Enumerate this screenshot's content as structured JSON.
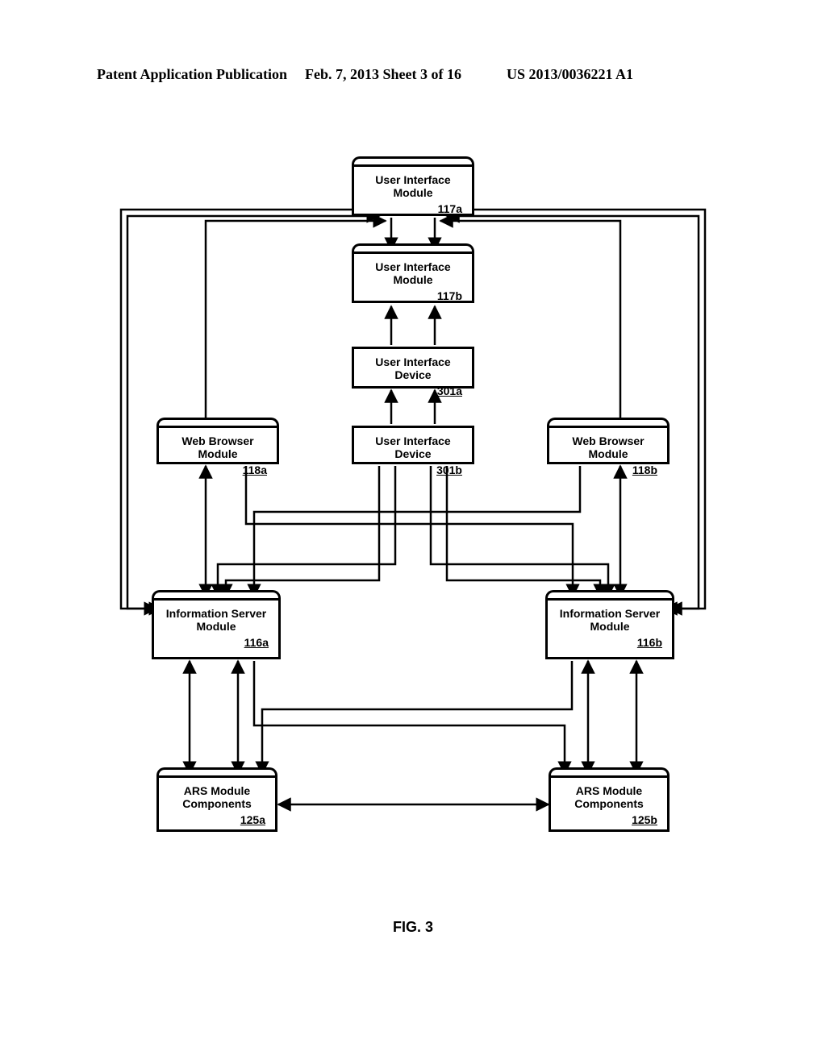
{
  "header": {
    "left": "Patent Application Publication",
    "mid": "Feb. 7, 2013  Sheet 3 of 16",
    "right": "US 2013/0036221 A1"
  },
  "figure_caption": "FIG. 3",
  "boxes": {
    "uim_a": {
      "title": "User Interface Module",
      "ref": "117a"
    },
    "uim_b": {
      "title": "User Interface Module",
      "ref": "117b"
    },
    "uid_a": {
      "title": "User Interface Device",
      "ref": "301a"
    },
    "uid_b": {
      "title": "User Interface Device",
      "ref": "301b"
    },
    "wbm_a": {
      "title": "Web Browser Module",
      "ref": "118a"
    },
    "wbm_b": {
      "title": "Web Browser Module",
      "ref": "118b"
    },
    "ism_a": {
      "title": "Information Server Module",
      "ref": "116a"
    },
    "ism_b": {
      "title": "Information Server Module",
      "ref": "116b"
    },
    "ars_a": {
      "title": "ARS Module Components",
      "ref": "125a"
    },
    "ars_b": {
      "title": "ARS Module Components",
      "ref": "125b"
    }
  }
}
